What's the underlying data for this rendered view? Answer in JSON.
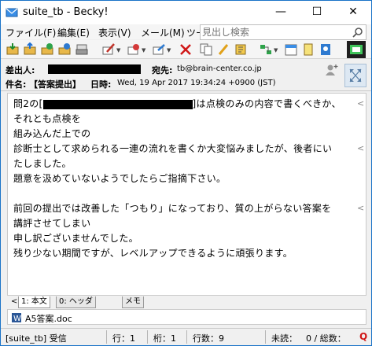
{
  "window": {
    "title": "suite_tb - Becky!",
    "minimize": "—",
    "maximize": "☐",
    "close": "✕"
  },
  "menu": [
    "ファイル(F)",
    "編集(E)",
    "表示(V)",
    "メール(M)",
    "ツー"
  ],
  "search": {
    "placeholder": "見出し検索"
  },
  "toolbar": {
    "icons": [
      "receive-mail-icon",
      "send-mail-icon",
      "download-icon",
      "upload-icon",
      "print-icon",
      "compose-icon",
      "reply-icon",
      "forward-icon",
      "delete-icon",
      "copy-icon",
      "edit-icon",
      "flag-icon",
      "filter-icon",
      "calendar-icon",
      "note-icon",
      "address-book-icon"
    ]
  },
  "header": {
    "from_label": "差出人:",
    "to_label": "宛先:",
    "to_value": "tb@brain-center.co.jp",
    "subject_label": "件名:",
    "subject_value": "【答案提出】",
    "date_label": "日時:",
    "date_value": "Wed, 19 Apr 2017 19:34:24 +0900 (JST)"
  },
  "body": {
    "lines": [
      "問2の[",
      "それとも点検を",
      "組み込んだ上での",
      "診断士として求められる一連の流れを書くか大変悩みましたが、後者にい",
      "たしました。",
      "題意を汲めていないようでしたらご指摘下さい。",
      "",
      "前回の提出では改善した「つもり」になっており、質の上がらない答案を",
      "講評させてしまい",
      "申し訳ございませんでした。",
      "残り少ない期間ですが、レベルアップできるように頑張ります。"
    ],
    "line1_suffix": "]は点検のみの内容で書くべきか、",
    "wrap_mark": "<"
  },
  "tabs": {
    "scroll_left": "<",
    "main": "1: 本文",
    "headers": "0: ヘッダ",
    "memo": "メモ"
  },
  "attachment": {
    "name": "A5答案.doc"
  },
  "status": {
    "folder": "[suite_tb] 受信",
    "line": "行：1",
    "column": "桁：1",
    "line_count": "行数：9",
    "unread": "未読：",
    "total": "0 / 総数：",
    "badge": "Q"
  },
  "colors": {
    "accent": "#1a73c8",
    "badge_red": "#d01818"
  }
}
